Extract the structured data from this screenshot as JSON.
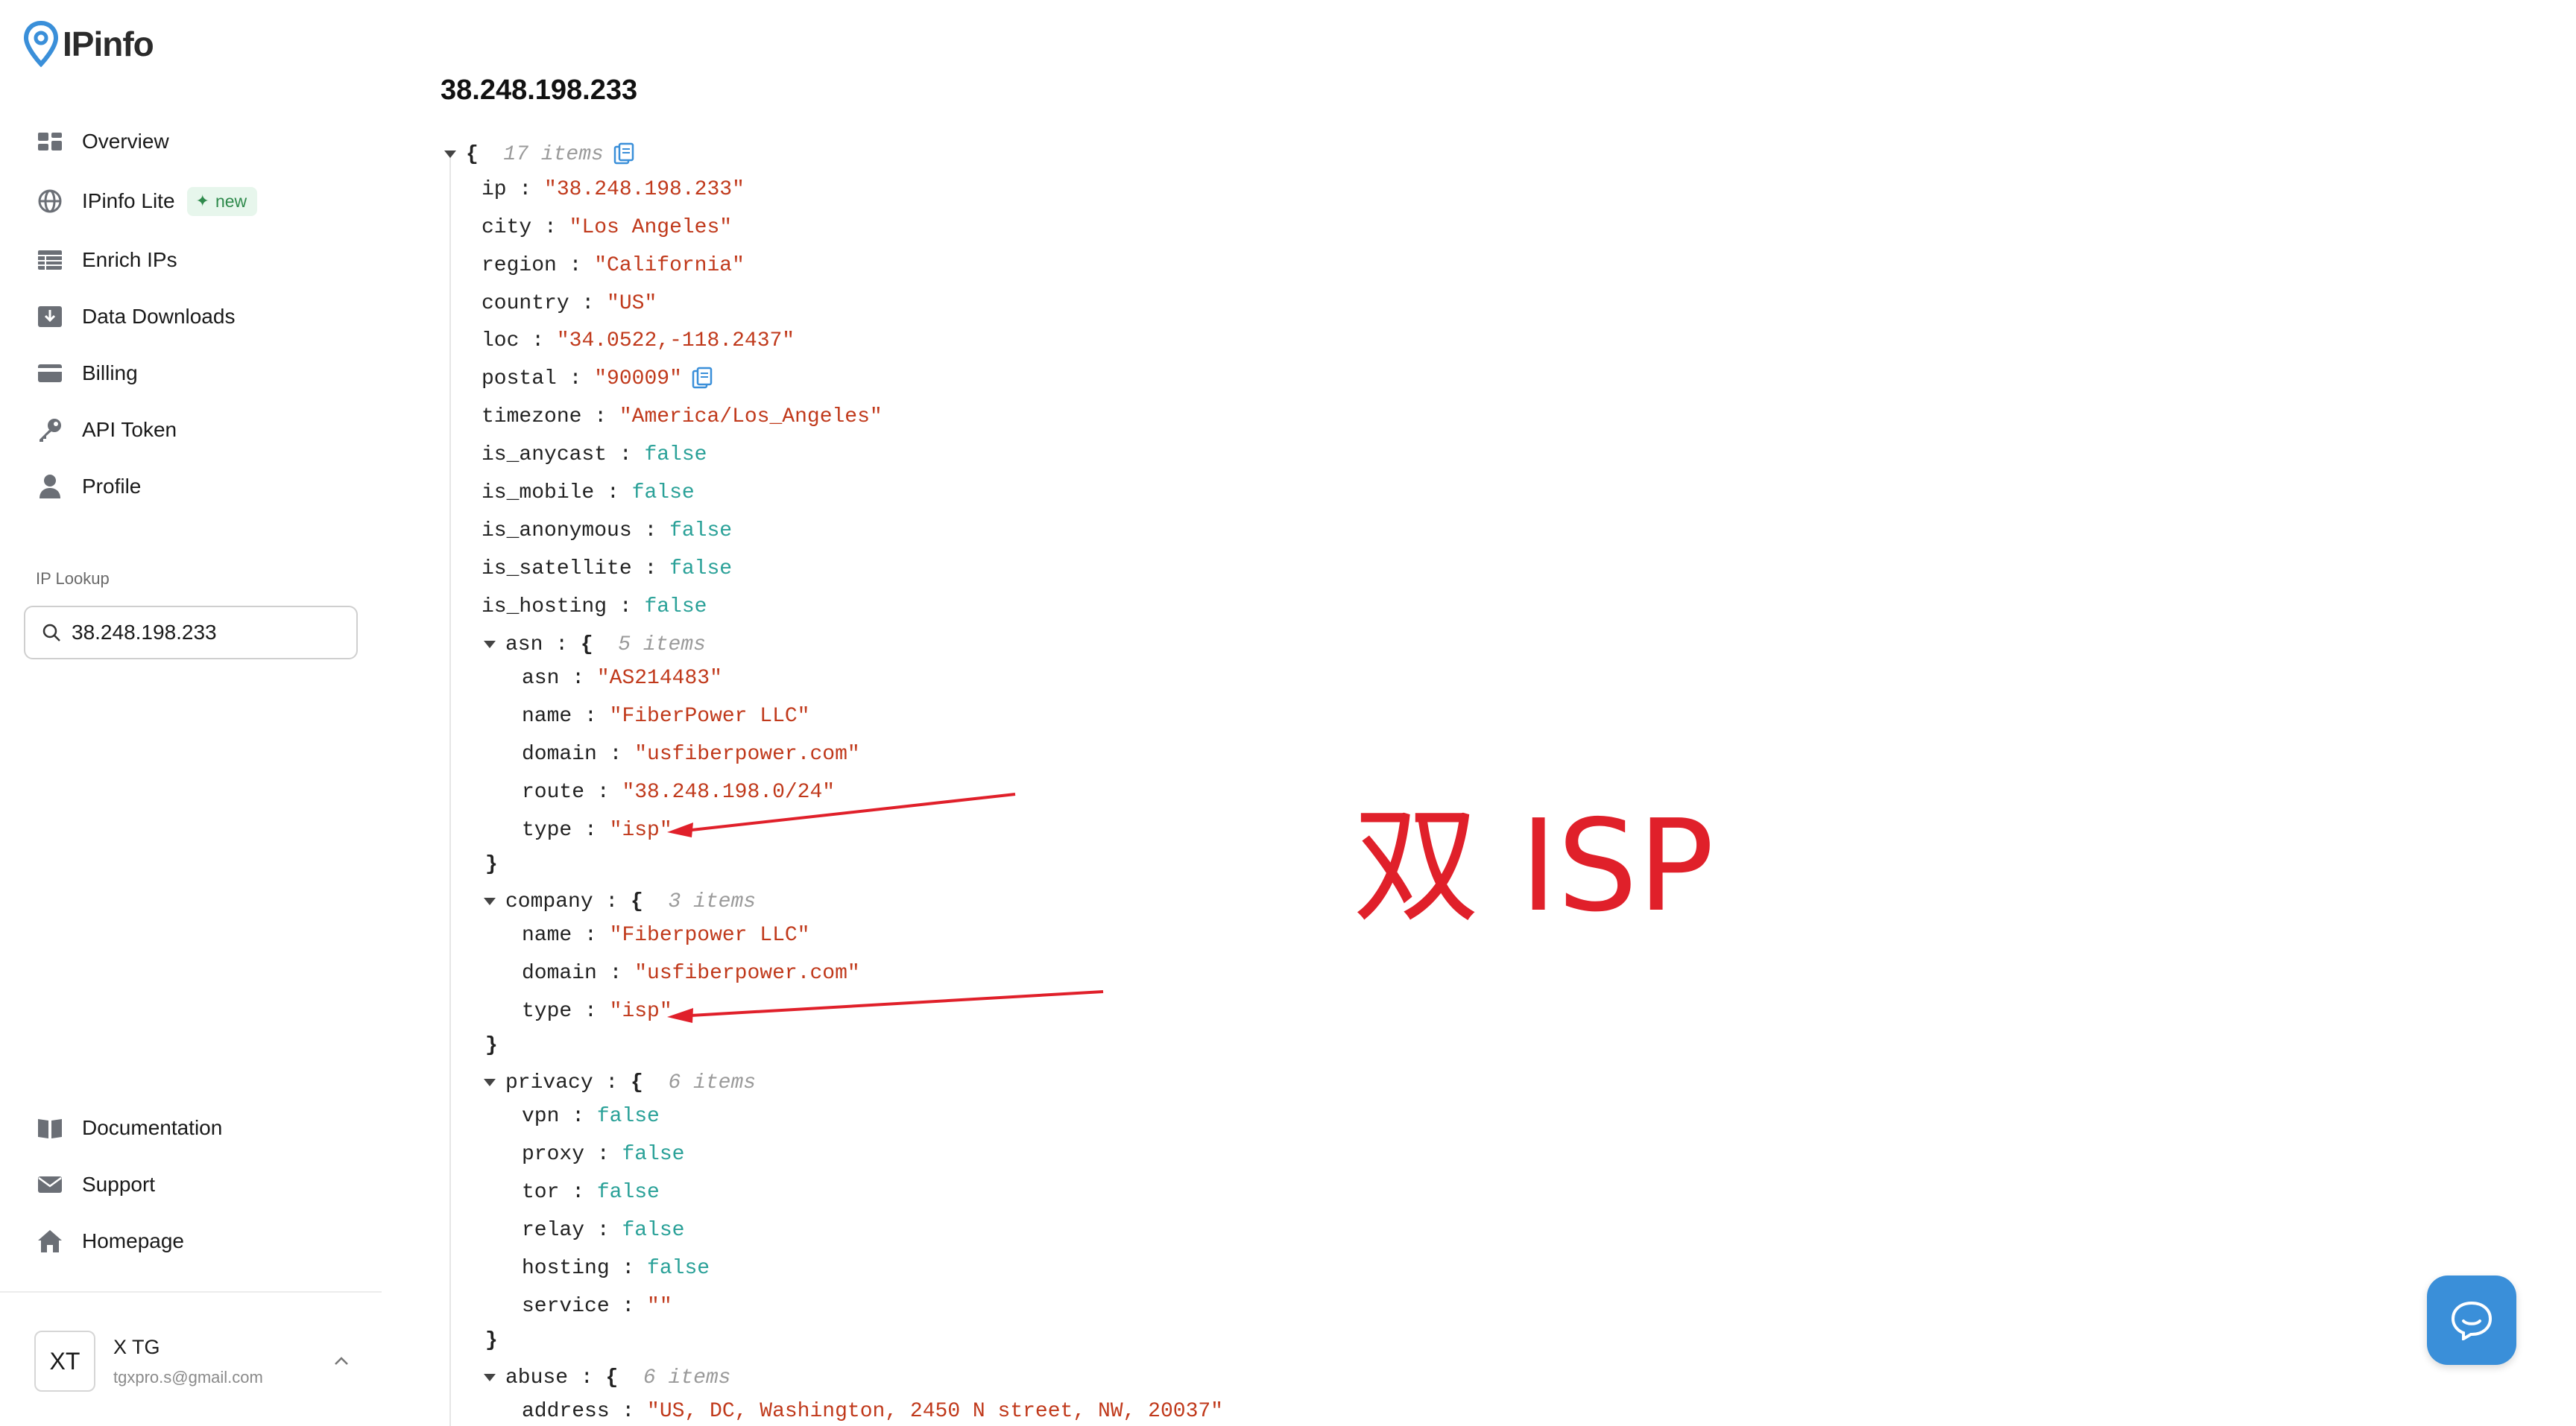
{
  "brand": {
    "name": "IPinfo",
    "color": "#3a8fd9"
  },
  "sidebar": {
    "nav": [
      {
        "label": "Overview",
        "icon": "overview-icon"
      },
      {
        "label": "IPinfo Lite",
        "icon": "globe-icon",
        "badge": "new"
      },
      {
        "label": "Enrich IPs",
        "icon": "table-icon"
      },
      {
        "label": "Data Downloads",
        "icon": "download-icon"
      },
      {
        "label": "Billing",
        "icon": "credit-card-icon"
      },
      {
        "label": "API Token",
        "icon": "key-icon"
      },
      {
        "label": "Profile",
        "icon": "user-icon"
      }
    ],
    "ip_lookup_label": "IP Lookup",
    "search_value": "38.248.198.233",
    "footer_nav": [
      {
        "label": "Documentation",
        "icon": "book-icon"
      },
      {
        "label": "Support",
        "icon": "mail-icon"
      },
      {
        "label": "Homepage",
        "icon": "home-icon"
      }
    ],
    "user": {
      "initials": "XT",
      "name": "X TG",
      "email": "tgxpro.s@gmail.com"
    }
  },
  "main": {
    "title": "38.248.198.233",
    "root_meta": "17 items",
    "fields": {
      "ip": "\"38.248.198.233\"",
      "city": "\"Los Angeles\"",
      "region": "\"California\"",
      "country": "\"US\"",
      "loc": "\"34.0522,-118.2437\"",
      "postal": "\"90009\"",
      "timezone": "\"America/Los_Angeles\"",
      "is_anycast": "false",
      "is_mobile": "false",
      "is_anonymous": "false",
      "is_satellite": "false",
      "is_hosting": "false"
    },
    "asn": {
      "meta": "5 items",
      "asn": "\"AS214483\"",
      "name": "\"FiberPower LLC\"",
      "domain": "\"usfiberpower.com\"",
      "route": "\"38.248.198.0/24\"",
      "type": "\"isp\""
    },
    "company": {
      "meta": "3 items",
      "name": "\"Fiberpower LLC\"",
      "domain": "\"usfiberpower.com\"",
      "type": "\"isp\""
    },
    "privacy": {
      "meta": "6 items",
      "vpn": "false",
      "proxy": "false",
      "tor": "false",
      "relay": "false",
      "hosting": "false",
      "service": "\"\""
    },
    "abuse": {
      "meta": "6 items",
      "address": "\"US, DC, Washington, 2450 N street, NW, 20037\""
    }
  },
  "annotation": {
    "text": "双 ISP",
    "color": "#e0202a"
  }
}
